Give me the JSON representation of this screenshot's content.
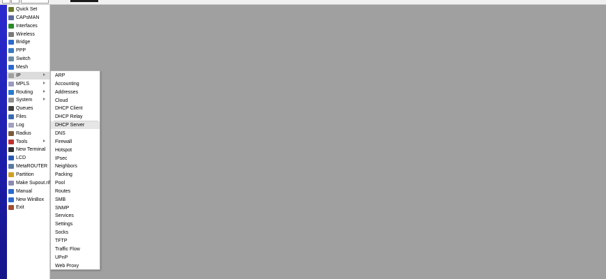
{
  "sidebar": {
    "items": [
      {
        "label": "Quick Set",
        "icon": "quick-set-icon",
        "color": "#6a7a2a"
      },
      {
        "label": "CAPsMAN",
        "icon": "capsman-icon",
        "color": "#5a6a9a"
      },
      {
        "label": "Interfaces",
        "icon": "interfaces-icon",
        "color": "#2a8a2a"
      },
      {
        "label": "Wireless",
        "icon": "wireless-icon",
        "color": "#7a7a7a"
      },
      {
        "label": "Bridge",
        "icon": "bridge-icon",
        "color": "#2a6ad0"
      },
      {
        "label": "PPP",
        "icon": "ppp-icon",
        "color": "#3a7ac0"
      },
      {
        "label": "Switch",
        "icon": "switch-icon",
        "color": "#6a8aa0"
      },
      {
        "label": "Mesh",
        "icon": "mesh-icon",
        "color": "#2a6ad0"
      },
      {
        "label": "IP",
        "icon": "ip-icon",
        "color": "#a0a0a0",
        "submenu": true,
        "active": true
      },
      {
        "label": "MPLS",
        "icon": "mpls-icon",
        "color": "#9a9ac0",
        "submenu": true
      },
      {
        "label": "Routing",
        "icon": "routing-icon",
        "color": "#2a7ad0",
        "submenu": true
      },
      {
        "label": "System",
        "icon": "system-icon",
        "color": "#909090",
        "submenu": true
      },
      {
        "label": "Queues",
        "icon": "queues-icon",
        "color": "#404040"
      },
      {
        "label": "Files",
        "icon": "files-icon",
        "color": "#3a6ab0"
      },
      {
        "label": "Log",
        "icon": "log-icon",
        "color": "#a0a0c0"
      },
      {
        "label": "Radius",
        "icon": "radius-icon",
        "color": "#7a5a3a"
      },
      {
        "label": "Tools",
        "icon": "tools-icon",
        "color": "#c03030",
        "submenu": true
      },
      {
        "label": "New Terminal",
        "icon": "terminal-icon",
        "color": "#303030"
      },
      {
        "label": "LCD",
        "icon": "lcd-icon",
        "color": "#2a5ab0"
      },
      {
        "label": "MetaROUTER",
        "icon": "metarouter-icon",
        "color": "#5a7aa0"
      },
      {
        "label": "Partition",
        "icon": "partition-icon",
        "color": "#d0a020"
      },
      {
        "label": "Make Supout.rif",
        "icon": "supout-icon",
        "color": "#8a8ab0"
      },
      {
        "label": "Manual",
        "icon": "manual-icon",
        "color": "#2a6ad0"
      },
      {
        "label": "New WinBox",
        "icon": "winbox-icon",
        "color": "#2a6ad0"
      },
      {
        "label": "Exit",
        "icon": "exit-icon",
        "color": "#a05030"
      }
    ]
  },
  "ip_submenu": {
    "items": [
      "ARP",
      "Accounting",
      "Addresses",
      "Cloud",
      "DHCP Client",
      "DHCP Relay",
      "DHCP Server",
      "DNS",
      "Firewall",
      "Hotspot",
      "IPsec",
      "Neighbors",
      "Packing",
      "Pool",
      "Routes",
      "SMB",
      "SNMP",
      "Services",
      "Settings",
      "Socks",
      "TFTP",
      "Traffic Flow",
      "UPnP",
      "Web Proxy"
    ],
    "hovered": "DHCP Server"
  },
  "colors": {
    "accent_strip": "#1c1ca8",
    "workspace": "#a0a0a0"
  }
}
